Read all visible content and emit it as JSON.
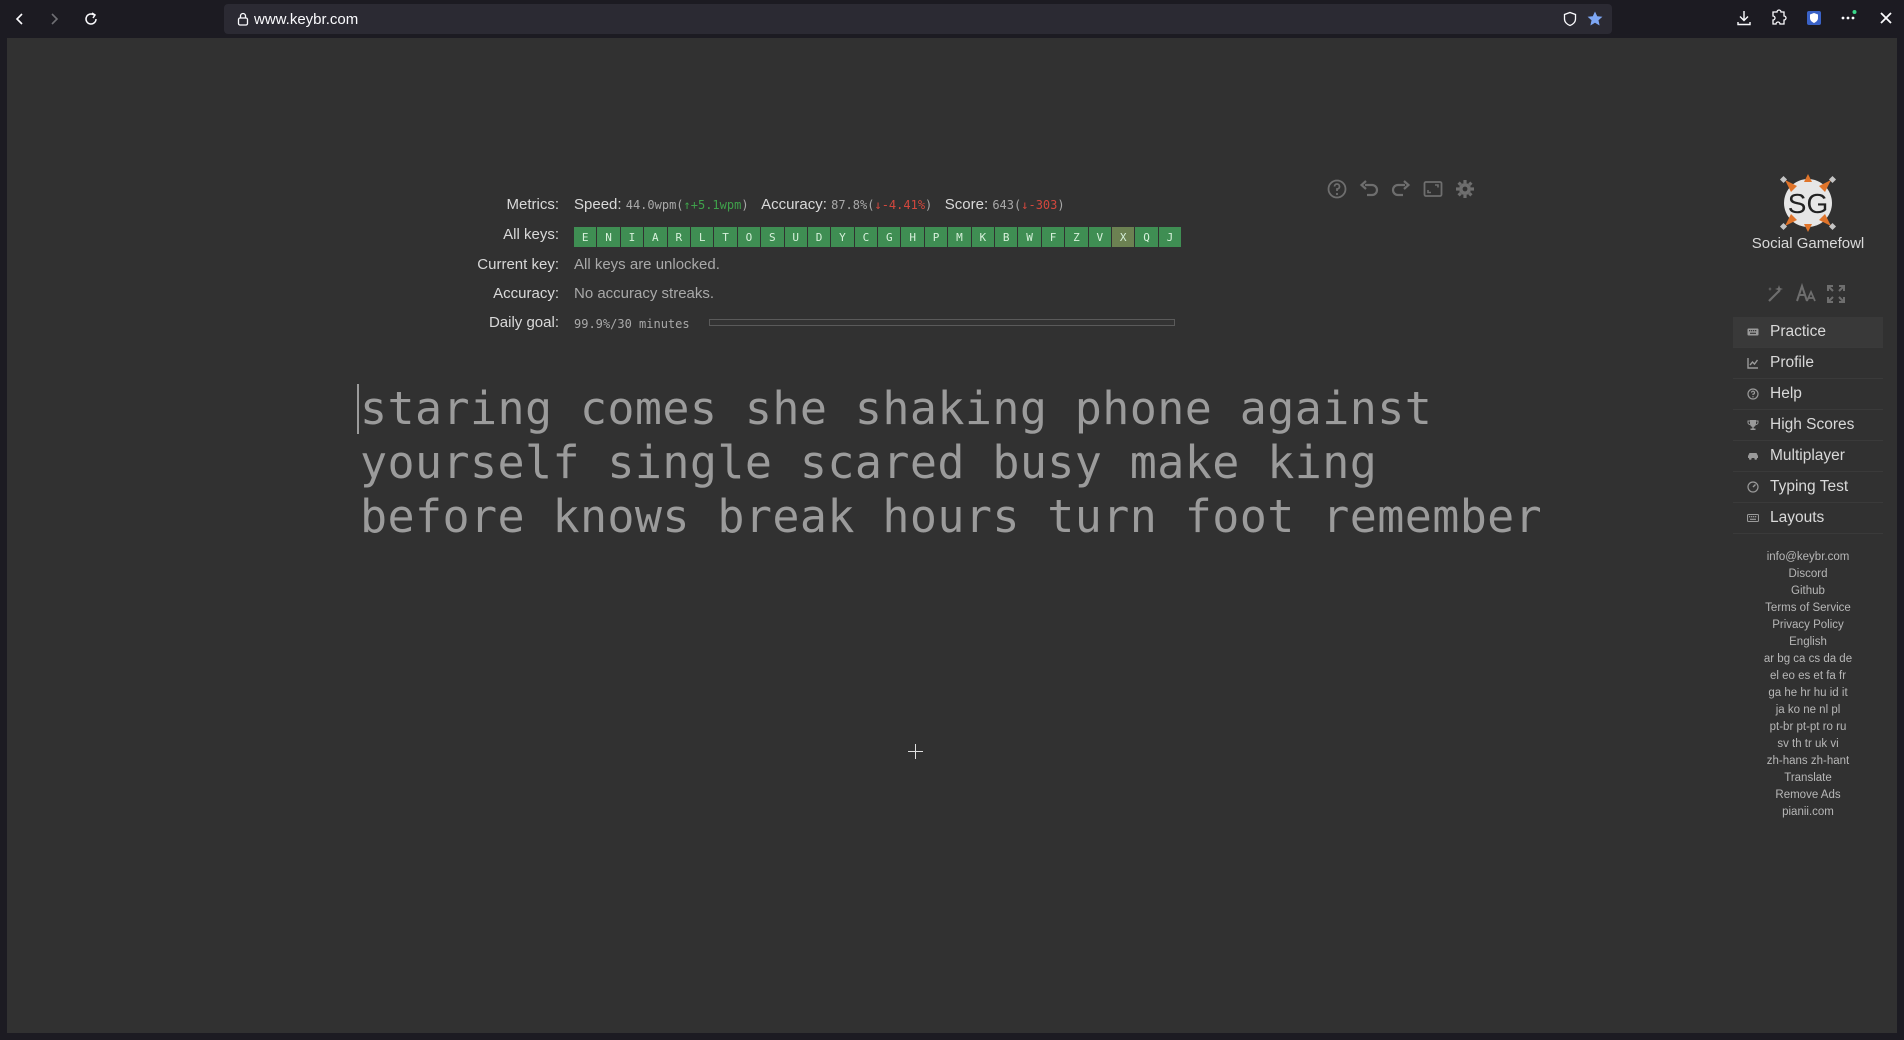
{
  "browser": {
    "url": "www.keybr.com"
  },
  "metrics": {
    "label": "Metrics:",
    "speed_label": "Speed:",
    "speed_value": "44.0wpm",
    "speed_delta": "↑+5.1wpm",
    "accuracy_label": "Accuracy:",
    "accuracy_value": "87.8%",
    "accuracy_delta": "↓-4.41%",
    "score_label": "Score:",
    "score_value": "643",
    "score_delta": "↓-303"
  },
  "all_keys": {
    "label": "All keys:",
    "keys": [
      "E",
      "N",
      "I",
      "A",
      "R",
      "L",
      "T",
      "O",
      "S",
      "U",
      "D",
      "Y",
      "C",
      "G",
      "H",
      "P",
      "M",
      "K",
      "B",
      "W",
      "F",
      "Z",
      "V",
      "X",
      "Q",
      "J"
    ]
  },
  "current_key": {
    "label": "Current key:",
    "value": "All keys are unlocked."
  },
  "accuracy_streak": {
    "label": "Accuracy:",
    "value": "No accuracy streaks."
  },
  "daily_goal": {
    "label": "Daily goal:",
    "value": "99.9%/30 minutes",
    "progress": 0.999
  },
  "practice": {
    "lines": [
      "staring comes she shaking phone against",
      "yourself single scared busy make king",
      "before knows break hours turn foot remember"
    ]
  },
  "user": {
    "initials": "SG",
    "name": "Social Gamefowl"
  },
  "menu": [
    {
      "label": "Practice",
      "icon": "keyboard-icon"
    },
    {
      "label": "Profile",
      "icon": "chart-icon"
    },
    {
      "label": "Help",
      "icon": "help-icon"
    },
    {
      "label": "High Scores",
      "icon": "trophy-icon"
    },
    {
      "label": "Multiplayer",
      "icon": "car-icon"
    },
    {
      "label": "Typing Test",
      "icon": "gauge-icon"
    },
    {
      "label": "Layouts",
      "icon": "keyboard-icon"
    }
  ],
  "footer_links": [
    "info@keybr.com",
    "Discord",
    "Github",
    "Terms of Service",
    "Privacy Policy",
    "English",
    "ar bg ca cs da de",
    "el eo es et fa fr",
    "ga he hr hu id it",
    "ja ko ne nl pl",
    "pt-br pt-pt ro ru",
    "sv th tr uk vi",
    "zh-hans zh-hant",
    "Translate",
    "Remove Ads",
    "pianii.com"
  ],
  "colors": {
    "key_green": "#3f8e53",
    "positive": "#3fa14b",
    "negative": "#d2473d",
    "background": "#313131"
  }
}
